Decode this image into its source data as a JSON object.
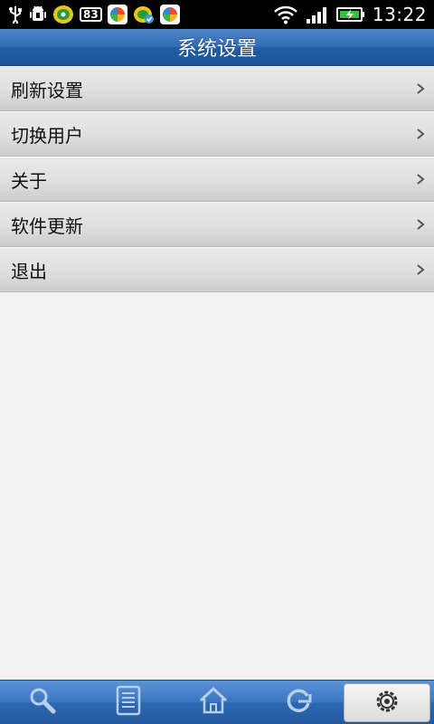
{
  "status_bar": {
    "badge_count": "83",
    "time": "13:22"
  },
  "header": {
    "title": "系统设置"
  },
  "menu": {
    "items": [
      {
        "label": "刷新设置",
        "chevron": ">"
      },
      {
        "label": "切换用户",
        "chevron": ">"
      },
      {
        "label": "关于",
        "chevron": ">"
      },
      {
        "label": "软件更新",
        "chevron": ">"
      },
      {
        "label": "退出",
        "chevron": ">"
      }
    ]
  },
  "tabs": {
    "items": [
      {
        "icon": "search-icon"
      },
      {
        "icon": "document-icon"
      },
      {
        "icon": "home-icon"
      },
      {
        "icon": "refresh-icon"
      },
      {
        "icon": "settings-icon",
        "active": true
      }
    ]
  },
  "colors": {
    "title_bar": "#2f6bb3",
    "tab_bar": "#3a76c2",
    "background": "#f2f2f2"
  }
}
